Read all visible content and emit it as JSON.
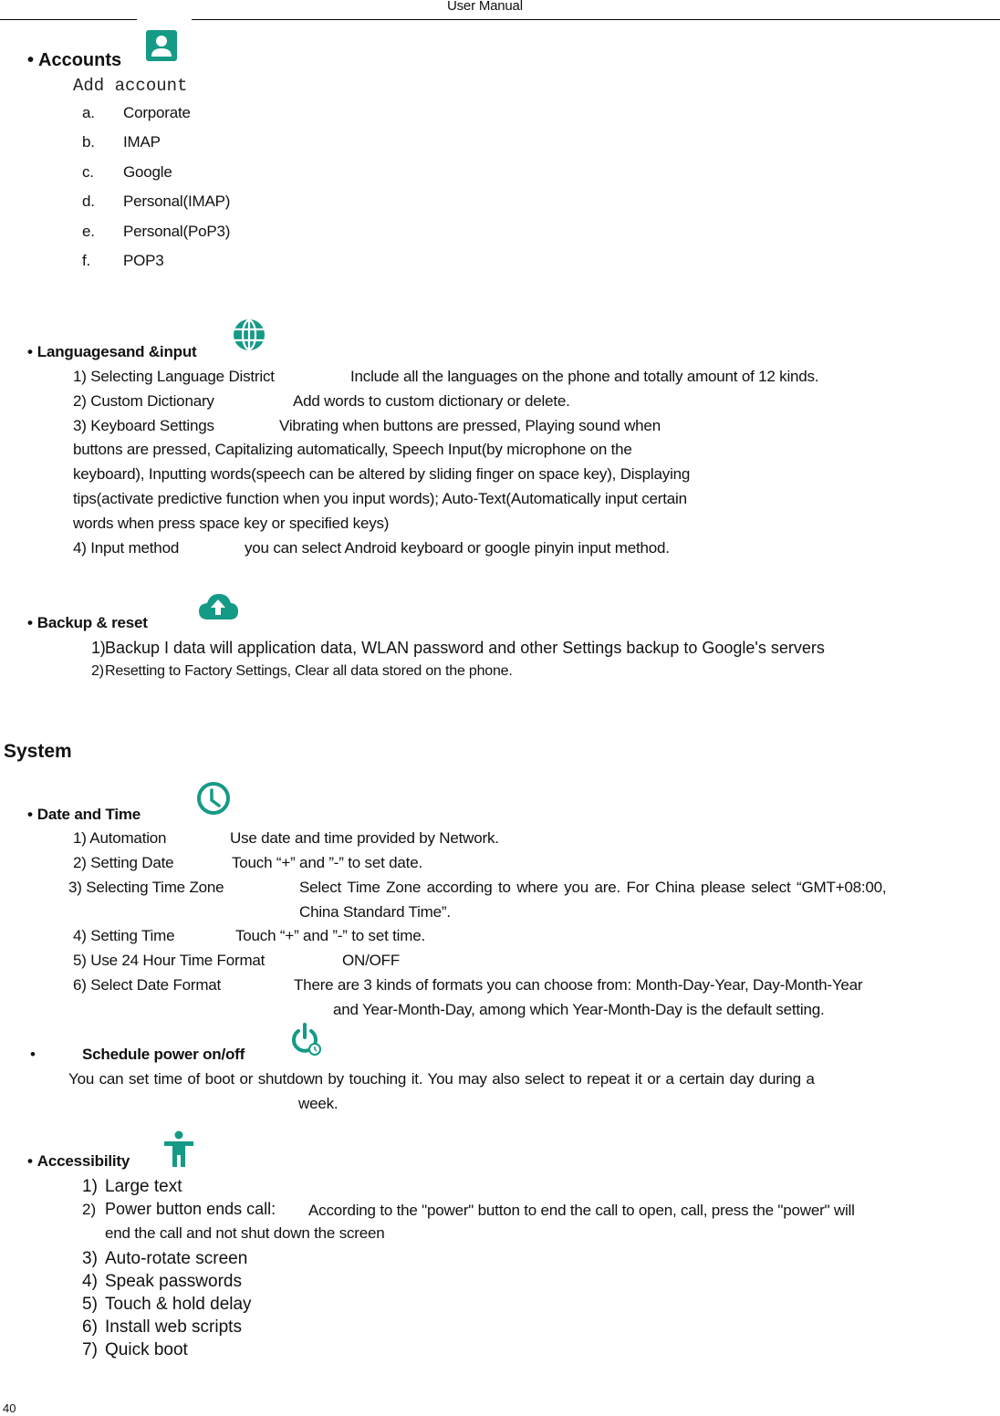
{
  "header": {
    "title": "User    Manual"
  },
  "accent_color": "#159a86",
  "accounts": {
    "title": "Accounts",
    "icon": "account-icon",
    "subtitle": "Add account",
    "items": [
      {
        "marker": "a.",
        "label": "Corporate"
      },
      {
        "marker": "b.",
        "label": "IMAP"
      },
      {
        "marker": "c.",
        "label": "Google"
      },
      {
        "marker": "d.",
        "label": "Personal(IMAP)"
      },
      {
        "marker": "e.",
        "label": "Personal(PoP3)"
      },
      {
        "marker": "f.",
        "label": "POP3"
      }
    ]
  },
  "languages": {
    "title": "Languagesand &input",
    "icon": "globe-icon",
    "items": [
      {
        "label": "1) Selecting Language District",
        "desc": "Include all the languages on the phone and totally amount of 12 kinds."
      },
      {
        "label": "2) Custom Dictionary",
        "desc": "Add words to custom dictionary or delete."
      },
      {
        "label": "3) Keyboard Settings",
        "desc": "Vibrating when buttons are pressed, Playing sound when"
      },
      {
        "label": "4) Input method",
        "desc": "you can select Android keyboard or google pinyin input method."
      }
    ],
    "keyboard_cont": [
      "buttons are pressed, Capitalizing automatically, Speech Input(by microphone on the",
      "keyboard), Inputting words(speech can be altered by sliding finger on space key), Displaying",
      "tips(activate predictive function when you input words); Auto-Text(Automatically input certain",
      "words when press space key or specified keys)"
    ]
  },
  "backup": {
    "title": "Backup & reset",
    "icon": "cloud-upload-icon",
    "items": [
      {
        "marker": "1)",
        "label": "Backup I data will application data, WLAN password and other Settings backup to Google's servers"
      },
      {
        "marker": "2)",
        "label": "Resetting to Factory Settings, Clear all data stored on the phone."
      }
    ]
  },
  "system": {
    "heading": "System",
    "date_time": {
      "title": "Date and Time",
      "icon": "clock-icon",
      "items": [
        {
          "label": "1) Automation",
          "desc": "Use date and time provided by Network."
        },
        {
          "label": "2) Setting Date",
          "desc": "Touch “+” and ”-” to set date."
        },
        {
          "label": "3) Selecting Time Zone",
          "desc": "Select Time Zone according to where you are. For China please select “GMT+08:00,",
          "desc2": "China Standard Time”."
        },
        {
          "label": "4) Setting Time",
          "desc": "Touch “+” and ”-” to set time."
        },
        {
          "label": "5) Use 24 Hour Time Format",
          "desc": "ON/OFF"
        },
        {
          "label": "6) Select Date Format",
          "desc": "There are 3 kinds of formats you can choose from: Month-Day-Year, Day-Month-Year",
          "desc2": "and Year-Month-Day, among which Year-Month-Day is the default setting."
        }
      ]
    },
    "schedule": {
      "title": "Schedule power on/off",
      "icon": "power-clock-icon",
      "desc": "You can set time of boot or shutdown by touching it. You may also select to repeat it or a certain day during a",
      "desc2": "week."
    },
    "accessibility": {
      "title": "Accessibility",
      "icon": "accessibility-icon",
      "items": [
        {
          "marker": "1)",
          "label": "Large text"
        },
        {
          "marker": "2)",
          "label": "Power button ends call:",
          "desc": "According to the \"power\" button to end the call to open, call, press the \"power\" will",
          "desc2": "end the call and not shut down the screen"
        },
        {
          "marker": "3)",
          "label": "Auto-rotate screen"
        },
        {
          "marker": "4)",
          "label": "Speak passwords"
        },
        {
          "marker": "5)",
          "label": "Touch & hold delay"
        },
        {
          "marker": "6)",
          "label": "Install web scripts"
        },
        {
          "marker": "7)",
          "label": "Quick boot"
        }
      ]
    }
  },
  "footer": {
    "page_number": "40"
  }
}
